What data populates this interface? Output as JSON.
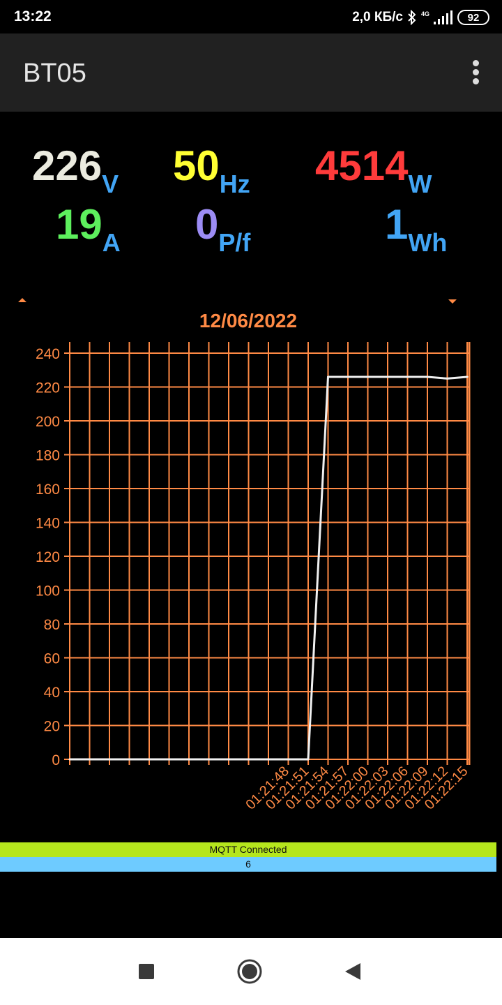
{
  "status_bar": {
    "time": "13:22",
    "net_speed": "2,0 КБ/с",
    "network_type": "4G",
    "battery": "92",
    "bluetooth_icon": "bluetooth-icon",
    "signal_icon": "signal-icon"
  },
  "app_bar": {
    "title": "BT05",
    "menu_icon": "more-vert-icon"
  },
  "readings": [
    {
      "value": "226",
      "unit": "V",
      "color": "#ebebe0"
    },
    {
      "value": "50",
      "unit": "Hz",
      "color": "#ffff33"
    },
    {
      "value": "4514",
      "unit": "W",
      "color": "#ff3b3b"
    },
    {
      "value": "19",
      "unit": "A",
      "color": "#5df05d"
    },
    {
      "value": "0",
      "unit": "P/f",
      "color": "#9c8cf5"
    },
    {
      "value": "1",
      "unit": "Wh",
      "color": "#42a5f5"
    }
  ],
  "unit_color": "#42a5f5",
  "chart_nav": {
    "up_icon": "arrow-up-icon",
    "down_icon": "arrow-down-icon"
  },
  "chart_data": {
    "type": "line",
    "title": "12/06/2022",
    "xlabel": "",
    "ylabel": "",
    "ylim": [
      0,
      240
    ],
    "yticks": [
      0,
      20,
      40,
      60,
      80,
      100,
      120,
      140,
      160,
      180,
      200,
      220,
      240
    ],
    "x_tick_labels": [
      "01:21:48",
      "01:21:51",
      "01:21:54",
      "01:21:57",
      "01:22:00",
      "01:22:03",
      "01:22:06",
      "01:22:09",
      "01:22:12",
      "01:22:15"
    ],
    "series": [
      {
        "values": [
          0,
          0,
          0,
          0,
          0,
          0,
          0,
          0,
          0,
          0,
          0,
          0,
          0,
          226,
          226,
          226,
          226,
          226,
          226,
          225,
          226
        ],
        "color": "#f0f0f0"
      }
    ],
    "grid": true,
    "grid_color": "#ff8a45"
  },
  "footer": {
    "mqtt_status": "MQTT Connected",
    "counter": "6"
  },
  "colors": {
    "accent": "#ff8a45",
    "mqtt_bar": "#b5e61d",
    "counter_bar": "#6ecbff"
  },
  "nav_bar": {
    "recents_icon": "square-icon",
    "home_icon": "circle-icon",
    "back_icon": "back-triangle-icon"
  }
}
